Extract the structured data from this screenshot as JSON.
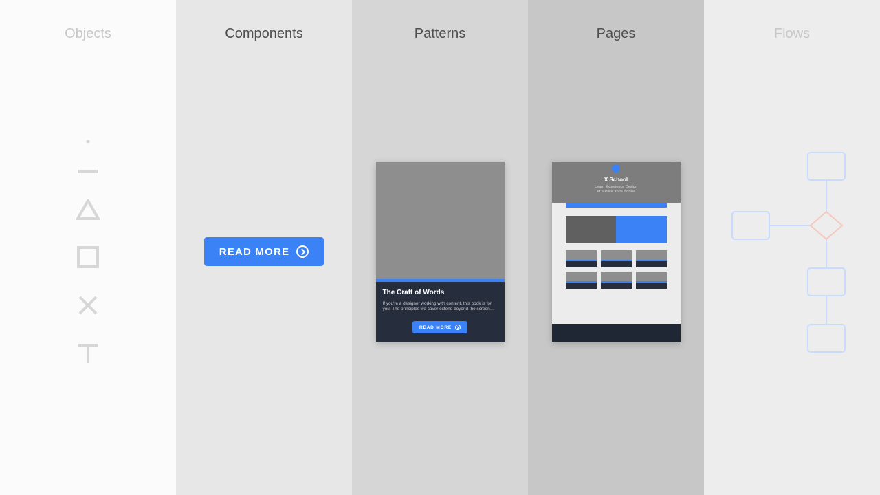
{
  "columns": {
    "objects": {
      "title": "Objects"
    },
    "components": {
      "title": "Components",
      "button": "READ MORE"
    },
    "patterns": {
      "title": "Patterns",
      "card": {
        "title": "The Craft of Words",
        "desc": "If you're a designer working with content, this book is for you. The principles we cover extend beyond the screen…",
        "button": "READ MORE"
      }
    },
    "pages": {
      "title": "Pages",
      "hero": {
        "title": "X School",
        "line1": "Learn Experience Design",
        "line2": "at a Pace You Choose"
      }
    },
    "flows": {
      "title": "Flows"
    }
  }
}
